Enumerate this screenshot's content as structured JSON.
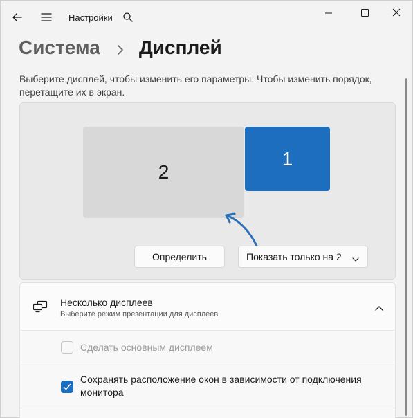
{
  "titlebar": {
    "app_title": "Настройки",
    "back_icon": "back-arrow-icon",
    "menu_icon": "hamburger-menu-icon",
    "search_icon": "search-icon",
    "window_controls": [
      "minimize-icon",
      "maximize-icon",
      "close-icon"
    ]
  },
  "breadcrumb": {
    "parent": "Система",
    "separator_icon": "chevron-right-icon",
    "current": "Дисплей"
  },
  "description": "Выберите дисплей, чтобы изменить его параметры. Чтобы изменить порядок, перетащите их в экран.",
  "displays": {
    "monitor_2_label": "2",
    "monitor_1_label": "1",
    "selected_color": "#1d6ebe",
    "unselected_color": "#d8d8d8",
    "annotation_arrow_color": "#2a6fb5"
  },
  "buttons": {
    "identify_label": "Определить",
    "dropdown_value": "Показать только на 2"
  },
  "multiple_displays": {
    "title": "Несколько дисплеев",
    "subtitle": "Выберите режим презентации для дисплеев",
    "icon": "multiple-monitors-icon",
    "expanded": true,
    "make_main_label": "Сделать основным дисплеем",
    "make_main_checked": false,
    "make_main_disabled": true,
    "remember_windows_label": "Сохранять расположение окон в зависимости от подключения монитора",
    "remember_windows_checked": true
  }
}
